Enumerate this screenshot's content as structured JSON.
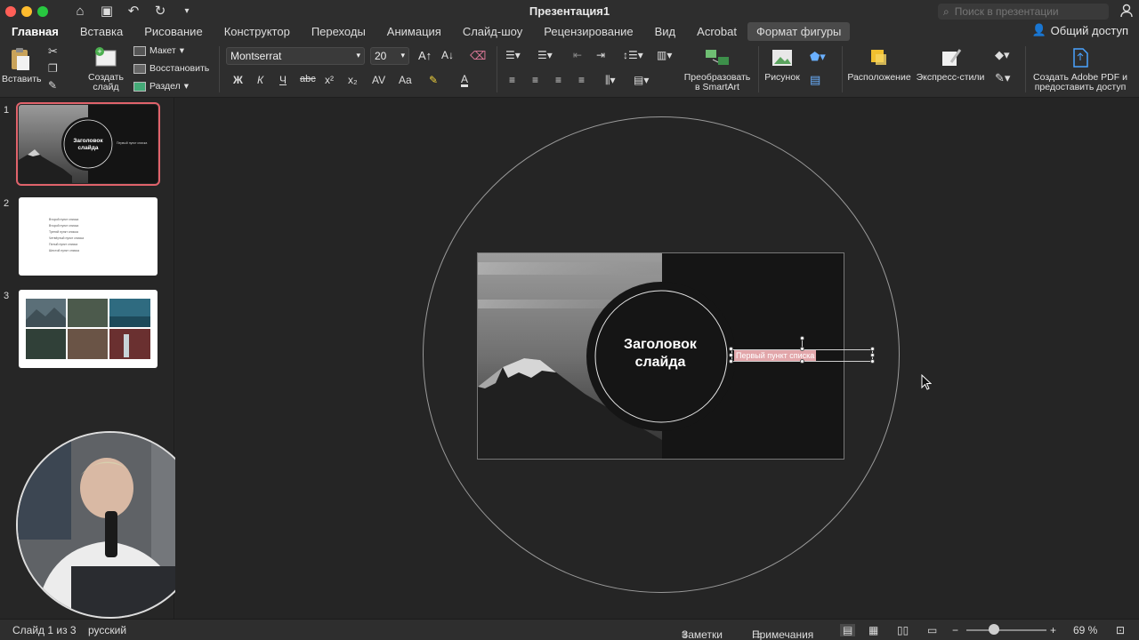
{
  "window": {
    "title": "Презентация1"
  },
  "search": {
    "placeholder": "Поиск в презентации"
  },
  "tabs": [
    {
      "label": "Главная"
    },
    {
      "label": "Вставка"
    },
    {
      "label": "Рисование"
    },
    {
      "label": "Конструктор"
    },
    {
      "label": "Переходы"
    },
    {
      "label": "Анимация"
    },
    {
      "label": "Слайд-шоу"
    },
    {
      "label": "Рецензирование"
    },
    {
      "label": "Вид"
    },
    {
      "label": "Acrobat"
    },
    {
      "label": "Формат фигуры"
    }
  ],
  "share": {
    "label": "Общий доступ"
  },
  "ribbon": {
    "paste": "Вставить",
    "new_slide_1": "Создать",
    "new_slide_2": "слайд",
    "layout": "Макет",
    "reset": "Восстановить",
    "section": "Раздел",
    "font": "Montserrat",
    "font_size": "20",
    "bold": "Ж",
    "italic": "К",
    "underline": "Ч",
    "strike": "abc",
    "smartart_1": "Преобразовать",
    "smartart_2": "в SmartArt",
    "picture": "Рисунок",
    "arrange": "Расположение",
    "quick_styles": "Экспресс-стили",
    "pdf_1": "Создать Adobe PDF и",
    "pdf_2": "предоставить доступ"
  },
  "slides": [
    {
      "number": "1",
      "title": "Заголовок слайда",
      "item": "Первый пункт списка"
    },
    {
      "number": "2",
      "lines": [
        "Второй пункт списка",
        "Второй пункт списка",
        "Третий пункт списка",
        "Четвёртый пункт списка",
        "Пятый пункт списка",
        "Шестой пункт списка"
      ]
    },
    {
      "number": "3"
    }
  ],
  "canvas": {
    "title_line1": "Заголовок",
    "title_line2": "слайда",
    "list_item": "Первый пункт списка"
  },
  "status": {
    "slide_counter": "Слайд 1 из 3",
    "language": "русский",
    "notes": "Заметки",
    "comments": "Примечания",
    "zoom": "69 %",
    "zoom_level": 0.69
  },
  "colors": {
    "accent": "#e0636b",
    "selection_fill": "#e2a6aa"
  }
}
